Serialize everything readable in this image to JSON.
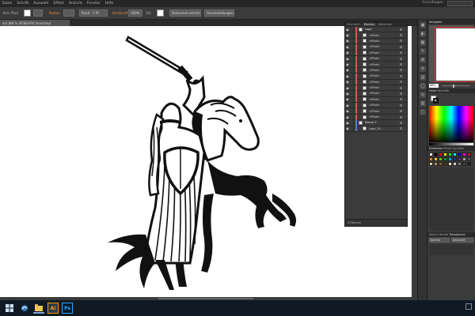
{
  "menubar": {
    "items": [
      "Datei",
      "Schrift",
      "Auswahl",
      "Effekt",
      "Ansicht",
      "Fenster",
      "Hilfe"
    ],
    "workspace": "Grundlagen"
  },
  "controlbar": {
    "no_selection": "Kein Pfad",
    "stroke_label": "Kontur:",
    "brush": "Rund - 5 Pt.",
    "opacity_label": "Deckkraft:",
    "opacity": "100%",
    "style_label": "Stil:",
    "doc_setup": "Dokument einrichten",
    "preferences": "Voreinstellungen"
  },
  "document": {
    "tab_title": "ect (88 % (RGB/GPU Vorschau)"
  },
  "layers_panel": {
    "tabs": [
      "Zeichenfl.",
      "Ebenen",
      "Bibliothek"
    ],
    "layer_name": "Logo",
    "sublayer_name": "<Pfad>",
    "layer2_name": "Ebene 2",
    "layer2_child": "Logo_Sk...",
    "footer": "2 Ebenen"
  },
  "right_panel": {
    "tabs": [
      "Navigator"
    ],
    "zoom": "88%",
    "color_tabs": [
      "Farbe",
      "Farbhilfe"
    ],
    "swatch_tabs": [
      "Farbfelder",
      "Pinsel",
      "Symbole"
    ],
    "trans_tabs": [
      "Kontur",
      "Verlauf",
      "Transparenz"
    ],
    "blend_mode": "Normal",
    "opacity_label": "Deckkraft"
  },
  "swatches": [
    "#ffffff",
    "#000000",
    "#ff0000",
    "#ffff00",
    "#00ff00",
    "#00ffff",
    "#0000ff",
    "#ff00ff",
    "#c8102e",
    "#e87722",
    "#ffd100",
    "#78be20",
    "#009639",
    "#00a3e0",
    "#0033a0",
    "#6d2077",
    "#a6a6a6",
    "#595959",
    "#e6c8a0",
    "#c09060",
    "#8a5a30",
    "#5a3818",
    "#f0e0c0",
    "#d0d0d0",
    "#808080",
    "#404040",
    "#202020"
  ],
  "colors": {
    "panel_bg": "#3b3b3b",
    "canvas_bg": "#535353",
    "accent": "#e8943a",
    "layer_color": "#d9534f"
  },
  "taskbar": {
    "apps": [
      "windows-icon",
      "edge-icon",
      "explorer-icon",
      "illustrator-icon",
      "photoshop-icon"
    ],
    "ai_label": "Ai",
    "ps_label": "Ps"
  }
}
